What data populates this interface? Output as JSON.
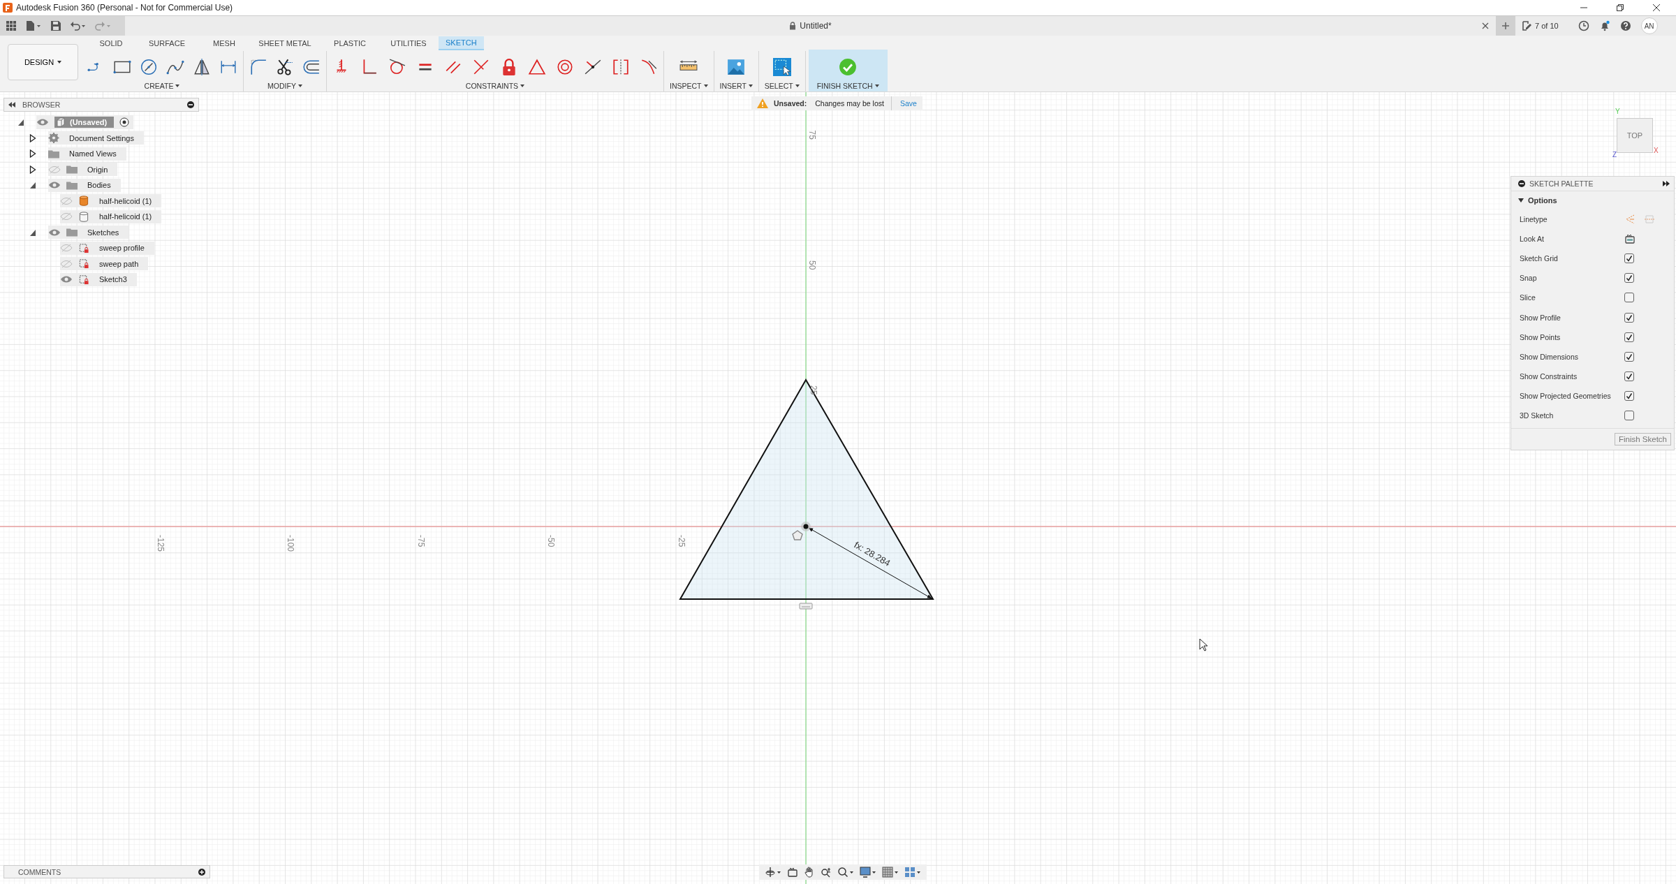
{
  "window": {
    "title": "Autodesk Fusion 360 (Personal - Not for Commercial Use)"
  },
  "document_tab": {
    "title": "Untitled*"
  },
  "job_status": {
    "label": "7 of 10"
  },
  "user": {
    "initials": "AN"
  },
  "workspace": {
    "label": "DESIGN"
  },
  "ribbon_tabs": [
    {
      "label": "SOLID",
      "selected": false
    },
    {
      "label": "SURFACE",
      "selected": false
    },
    {
      "label": "MESH",
      "selected": false
    },
    {
      "label": "SHEET METAL",
      "selected": false
    },
    {
      "label": "PLASTIC",
      "selected": false
    },
    {
      "label": "UTILITIES",
      "selected": false
    },
    {
      "label": "SKETCH",
      "selected": true
    }
  ],
  "tool_groups": [
    {
      "label": "CREATE",
      "kind": "create"
    },
    {
      "label": "MODIFY",
      "kind": "modify"
    },
    {
      "label": "CONSTRAINTS",
      "kind": "constraints"
    },
    {
      "label": "INSPECT",
      "kind": "inspect"
    },
    {
      "label": "INSERT",
      "kind": "insert"
    },
    {
      "label": "SELECT",
      "kind": "select"
    },
    {
      "label": "FINISH SKETCH",
      "kind": "finish"
    }
  ],
  "unsaved_notice": {
    "label": "Unsaved:",
    "message": "Changes may be lost",
    "action": "Save"
  },
  "browser": {
    "title": "BROWSER",
    "tree": [
      {
        "label": "(Unsaved)",
        "kind": "root",
        "expanded": true,
        "visible": true,
        "children": [
          {
            "label": "Document Settings",
            "kind": "settings",
            "expanded": false
          },
          {
            "label": "Named Views",
            "kind": "folder",
            "expanded": false
          },
          {
            "label": "Origin",
            "kind": "folder",
            "expanded": false,
            "visible": false
          },
          {
            "label": "Bodies",
            "kind": "folder",
            "expanded": true,
            "visible": true,
            "children": [
              {
                "label": "half-helicoid (1)",
                "kind": "body-highlight",
                "visible": false
              },
              {
                "label": "half-helicoid (1)",
                "kind": "body",
                "visible": false
              }
            ]
          },
          {
            "label": "Sketches",
            "kind": "folder",
            "expanded": true,
            "visible": true,
            "children": [
              {
                "label": "sweep profile",
                "kind": "sketch",
                "visible": false
              },
              {
                "label": "sweep path",
                "kind": "sketch",
                "visible": false
              },
              {
                "label": "Sketch3",
                "kind": "sketch",
                "visible": true
              }
            ]
          }
        ]
      }
    ]
  },
  "comments": {
    "title": "COMMENTS"
  },
  "sketch_palette": {
    "title": "SKETCH PALETTE",
    "section": "Options",
    "options": [
      {
        "label": "Linetype",
        "kind": "linetype"
      },
      {
        "label": "Look At",
        "kind": "look-at"
      },
      {
        "label": "Sketch Grid",
        "kind": "checkbox",
        "checked": true
      },
      {
        "label": "Snap",
        "kind": "checkbox",
        "checked": true
      },
      {
        "label": "Slice",
        "kind": "checkbox",
        "checked": false
      },
      {
        "label": "Show Profile",
        "kind": "checkbox",
        "checked": true
      },
      {
        "label": "Show Points",
        "kind": "checkbox",
        "checked": true
      },
      {
        "label": "Show Dimensions",
        "kind": "checkbox",
        "checked": true
      },
      {
        "label": "Show Constraints",
        "kind": "checkbox",
        "checked": true
      },
      {
        "label": "Show Projected Geometries",
        "kind": "checkbox",
        "checked": true
      },
      {
        "label": "3D Sketch",
        "kind": "checkbox",
        "checked": false
      }
    ],
    "button": "Finish Sketch"
  },
  "view_cube": {
    "face": "TOP",
    "x_label": "X",
    "y_label": "Y",
    "z_label": "Z"
  },
  "canvas": {
    "x_ticks": [
      "-125",
      "-100",
      "-75",
      "-50",
      "-25"
    ],
    "y_ticks": [
      "75",
      "50"
    ],
    "vertex_label": "25",
    "dimension": "fx: 28.284"
  }
}
